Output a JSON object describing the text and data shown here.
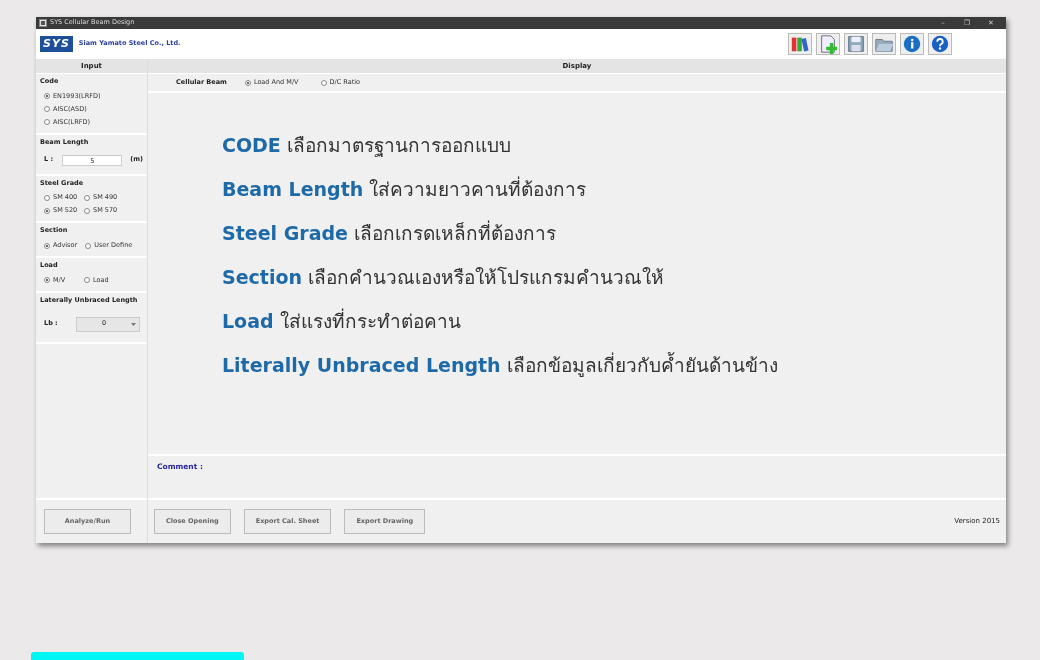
{
  "window": {
    "title": "SYS Cellular Beam Design",
    "controls": [
      "–",
      "❐",
      "✕"
    ]
  },
  "header": {
    "logo": "SYS",
    "company": "Siam Yamato Steel Co., Ltd."
  },
  "toolbar": [
    {
      "kind": "books"
    },
    {
      "kind": "new"
    },
    {
      "kind": "save"
    },
    {
      "kind": "open"
    },
    {
      "kind": "info"
    },
    {
      "kind": "help"
    }
  ],
  "input": {
    "title": "Input",
    "code": {
      "label": "Code",
      "options": [
        {
          "label": "EN1993(LRFD)",
          "selected": true
        },
        {
          "label": "AISC(ASD)",
          "selected": false
        },
        {
          "label": "AISC(LRFD)",
          "selected": false
        }
      ]
    },
    "beam_length": {
      "label": "Beam Length",
      "field_label": "L :",
      "value": "5",
      "unit": "(m)"
    },
    "steel_grade": {
      "label": "Steel Grade",
      "options": [
        {
          "label": "SM 400",
          "selected": false
        },
        {
          "label": "SM 490",
          "selected": false
        },
        {
          "label": "SM 520",
          "selected": true
        },
        {
          "label": "SM 570",
          "selected": false
        }
      ]
    },
    "section": {
      "label": "Section",
      "options": [
        {
          "label": "Advisor",
          "selected": true
        },
        {
          "label": "User Define",
          "selected": false
        }
      ]
    },
    "load": {
      "label": "Load",
      "options": [
        {
          "label": "M/V",
          "selected": true
        },
        {
          "label": "Load",
          "selected": false
        }
      ]
    },
    "unbraced": {
      "label": "Laterally Unbraced Length",
      "field_label": "Lb :",
      "value": "0"
    },
    "run_button": "Analyze/Run"
  },
  "display": {
    "title": "Display",
    "mode_label": "Cellular Beam",
    "modes": [
      {
        "label": "Load And M/V",
        "selected": true
      },
      {
        "label": "D/C Ratio",
        "selected": false
      }
    ],
    "instructions": [
      "**CODE** เลือกมาตรฐานการออกแบบ",
      "**Beam Length** ใส่ความยาวคานที่ต้องการ",
      "**Steel Grade** เลือกเกรดเหล็กที่ต้องการ",
      "**Section** เลือกคำนวณเองหรือให้โปรแกรมคำนวณให้",
      "**Load** ใส่แรงที่กระทำต่อคาน",
      "**Literally Unbraced Length** เลือกข้อมูลเกี่ยวกับค้ำยันด้านข้าง"
    ],
    "comment_label": "Comment :",
    "buttons": [
      "Close Opening",
      "Export Cal. Sheet",
      "Export Drawing"
    ],
    "version": "Version 2015"
  }
}
